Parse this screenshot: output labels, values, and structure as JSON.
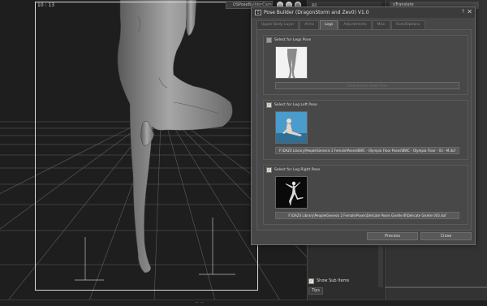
{
  "viewport": {
    "counter": "10 : 13",
    "tab_label": "DSPoseBuilderCam..."
  },
  "side": {
    "all_label": "All",
    "xtranslate_label": "xTranslate",
    "show_sub_items": {
      "label": "Show Sub Items",
      "checked": true
    },
    "tips_label": "Tips"
  },
  "dialog": {
    "title": "Pose Builder (DragonStorm and Zev0) V1.0",
    "help_glyph": "?",
    "close_glyph": "✕",
    "tabs": [
      {
        "label": "Upper Body Layer",
        "active": false
      },
      {
        "label": "Arms",
        "active": false
      },
      {
        "label": "Legs",
        "active": true
      },
      {
        "label": "Adjustments",
        "active": false
      },
      {
        "label": "Misc",
        "active": false
      },
      {
        "label": "Tools/Options",
        "active": false
      }
    ],
    "groups": [
      {
        "label": "Select for Legs Pose",
        "checked": false,
        "path": "Click Here to Select Pose",
        "path_disabled": true,
        "thumb": "legs-thumbnail"
      },
      {
        "label": "Select for Leg Left Pose",
        "checked": true,
        "path": "F:\\DAZ4 Library\\People\\Genesis 2 Female\\Poses\\BWC - Olympia Floor Poses\\BWC - Olympia Floor - 03 - M.duf",
        "path_disabled": false,
        "thumb": "sitting-pose-thumbnail"
      },
      {
        "label": "Select for Leg Right Pose",
        "checked": true,
        "path": "F:\\DAZ4 Library\\People\\Genesis 2 Female\\Poses\\Delicate Poses Giselle III\\Delicate Giselle 003.duf",
        "path_disabled": false,
        "thumb": "ballet-pose-thumbnail"
      }
    ],
    "process_label": "Process",
    "close_label": "Close"
  },
  "status_text": "— —"
}
